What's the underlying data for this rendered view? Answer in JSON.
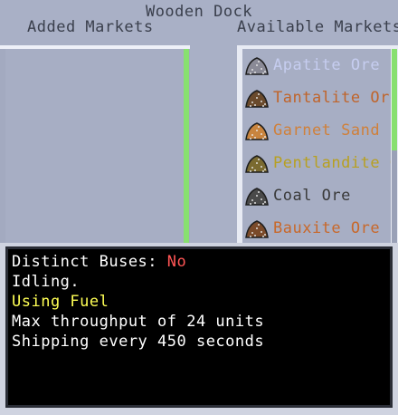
{
  "window": {
    "title": "Wooden Dock"
  },
  "headers": {
    "added": "Added Markets",
    "available": "Available Markets"
  },
  "available_markets": [
    {
      "label": "Apatite Ore",
      "color": "#c6cdf0",
      "icon": "apatite-ore-icon",
      "icon_color": "#8a8a96"
    },
    {
      "label": "Tantalite Ore",
      "color": "#c0642a",
      "icon": "tantalite-ore-icon",
      "icon_color": "#6a4a2c"
    },
    {
      "label": "Garnet Sand",
      "color": "#d0803a",
      "icon": "garnet-sand-icon",
      "icon_color": "#c8843e"
    },
    {
      "label": "Pentlandite Ore",
      "color": "#b8a020",
      "icon": "pentlandite-ore-icon",
      "icon_color": "#7a6a30"
    },
    {
      "label": "Coal Ore",
      "color": "#3a3a3a",
      "icon": "coal-ore-icon",
      "icon_color": "#4a4a4a"
    },
    {
      "label": "Bauxite Ore",
      "color": "#c8682a",
      "icon": "bauxite-ore-icon",
      "icon_color": "#7a4a2a"
    }
  ],
  "status": {
    "distinct_buses_label": "Distinct Buses: ",
    "distinct_buses_value": "No",
    "idle_text": "Idling.",
    "fuel_text": "Using Fuel",
    "throughput_text": "Max throughput of 24 units",
    "shipping_text": "Shipping every 450 seconds"
  }
}
